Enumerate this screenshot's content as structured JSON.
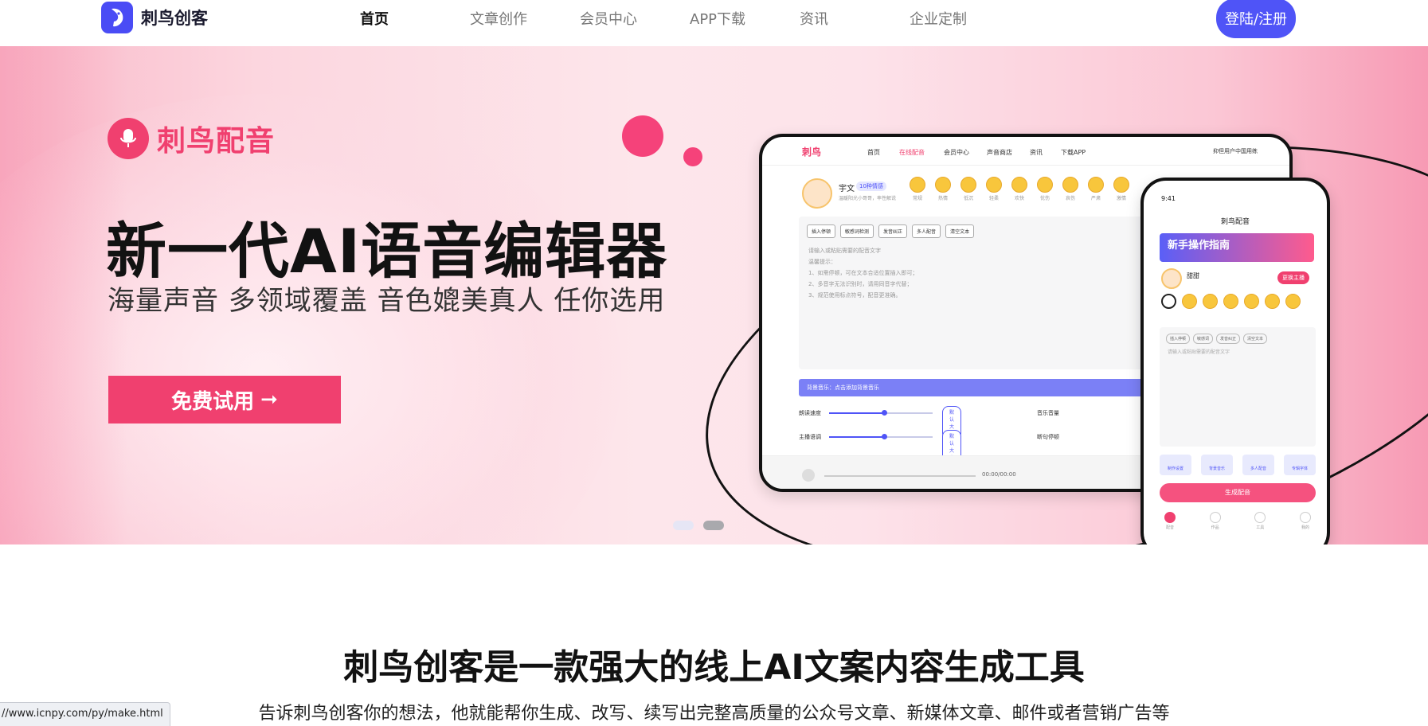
{
  "header": {
    "logo_text": "刺鸟创客",
    "nav": [
      "首页",
      "文章创作",
      "会员中心",
      "APP下载",
      "资讯",
      "企业定制"
    ],
    "login_label": "登陆/注册"
  },
  "banner": {
    "brand": "刺鸟配音",
    "title": "新一代AI语音编辑器",
    "subtitle": "海量声音 多领域覆盖 音色媲美真人 任你选用",
    "cta_label": "免费试用",
    "cta_arrow": "➞",
    "laptop": {
      "logo": "刺鸟",
      "nav": [
        "首页",
        "在线配音",
        "会员中心",
        "声音商店",
        "资讯",
        "下载APP"
      ],
      "user": "抑但用户中国用练",
      "voice_name": "宇文",
      "voice_tag": "10种情感",
      "voice_desc": "温暖阳光小哥哥，率性解说",
      "emotions": [
        "常规",
        "热情",
        "低沉",
        "轻柔",
        "欢快",
        "忧伤",
        "哀伤",
        "严肃",
        "激情"
      ],
      "tools": [
        "插入停顿",
        "敏感词检测",
        "发音纠正",
        "多人配音",
        "清空文本"
      ],
      "editor_text": [
        "请输入或粘贴需要的配音文字",
        "温馨提示：",
        "1、如需停顿，可在文本合适位置插入即可；",
        "2、多音字无法识别时，请用同音字代替；",
        "3、规范使用标点符号，配音更准确。"
      ],
      "bgm": "背景音乐：点击添加背景音乐",
      "sliders": [
        {
          "label": "朗读速度",
          "value": "默认大小"
        },
        {
          "label": "主播语调",
          "value": "默认大小"
        }
      ],
      "right_labels": [
        "音乐音量",
        "断句停顿"
      ],
      "time": "00:00/00:00"
    },
    "phone": {
      "status_time": "9:41",
      "title": "刺鸟配音",
      "banner_text": "新手操作指南",
      "voice_name": "甜甜",
      "change_label": "更换主播",
      "tools": [
        "插入停顿",
        "敏感词",
        "发音纠正",
        "清空文本"
      ],
      "editor_placeholder": "请输入或粘贴需要的配音文字",
      "icons": [
        "制作设置",
        "背景音乐",
        "多人配音",
        "专辑字体"
      ],
      "generate_label": "生成配音",
      "tabs": [
        "配音",
        "作品",
        "工具",
        "我的"
      ]
    }
  },
  "intro": {
    "title": "刺鸟创客是一款强大的线上AI文案内容生成工具",
    "description": "告诉刺鸟创客你的想法，他就能帮你生成、改写、续写出完整高质量的公众号文章、新媒体文章、邮件或者营销广告等"
  },
  "status_bar": {
    "url": "//www.icnpy.com/py/make.html"
  },
  "colors": {
    "accent_blue": "#4f54f7",
    "brand_pink": "#f0406f"
  }
}
